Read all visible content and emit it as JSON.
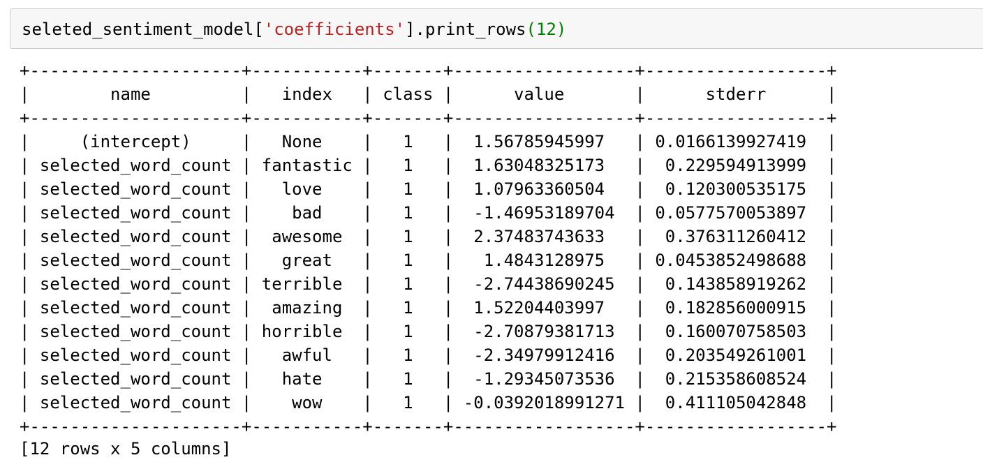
{
  "input_cell": {
    "code_prefix": "seleted_sentiment_model[",
    "code_string": "'coefficients'",
    "code_mid": "].print_rows",
    "code_paren_open": "(",
    "code_number": "12",
    "code_paren_close": ")"
  },
  "table": {
    "headers": [
      "name",
      "index",
      "class",
      "value",
      "stderr"
    ],
    "rows": [
      [
        "(intercept)",
        "None",
        "1",
        "1.56785945997",
        "0.0166139927419"
      ],
      [
        "selected_word_count",
        "fantastic",
        "1",
        "1.63048325173",
        "0.229594913999"
      ],
      [
        "selected_word_count",
        "love",
        "1",
        "1.07963360504",
        "0.120300535175"
      ],
      [
        "selected_word_count",
        "bad",
        "1",
        "-1.46953189704",
        "0.0577570053897"
      ],
      [
        "selected_word_count",
        "awesome",
        "1",
        "2.37483743633",
        "0.376311260412"
      ],
      [
        "selected_word_count",
        "great",
        "1",
        "1.4843128975",
        "0.0453852498688"
      ],
      [
        "selected_word_count",
        "terrible",
        "1",
        "-2.74438690245",
        "0.143858919262"
      ],
      [
        "selected_word_count",
        "amazing",
        "1",
        "1.52204403997",
        "0.182856000915"
      ],
      [
        "selected_word_count",
        "horrible",
        "1",
        "-2.70879381713",
        "0.160070758503"
      ],
      [
        "selected_word_count",
        "awful",
        "1",
        "-2.34979912416",
        "0.203549261001"
      ],
      [
        "selected_word_count",
        "hate",
        "1",
        "-1.29345073536",
        "0.215358608524"
      ],
      [
        "selected_word_count",
        "wow",
        "1",
        "-0.0392018991271",
        "0.411105042848"
      ]
    ],
    "footer": "[12 rows x 5 columns]"
  },
  "colors": {
    "cell_background": "#f7f7f7",
    "cell_border": "#cfcfcf",
    "string": "#ba2121",
    "number": "#008000"
  }
}
